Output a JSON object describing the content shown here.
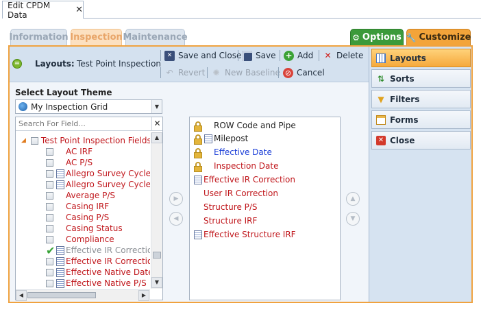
{
  "window": {
    "doc_tab_title": "Edit CPDM Data",
    "close_glyph": "✕"
  },
  "section_tabs": {
    "information": "Information",
    "inspection": "Inspection",
    "maintenance": "Maintenance",
    "options": "Options",
    "customize": "Customize"
  },
  "toolbar": {
    "layouts_label": "Layouts:",
    "layouts_value": "Test Point Inspection",
    "save_and_close": "Save and Close",
    "save": "Save",
    "add": "Add",
    "delete": "Delete",
    "revert": "Revert",
    "new_baseline": "New Baseline",
    "cancel": "Cancel"
  },
  "theme": {
    "label": "Select Layout Theme",
    "selected": "My Inspection Grid"
  },
  "search": {
    "placeholder": "Search For Field..."
  },
  "available_fields": {
    "group": "Test Point Inspection Fields",
    "items": [
      {
        "label": "AC IRF"
      },
      {
        "label": "AC P/S"
      },
      {
        "label": "Allegro Survey Cycle C"
      },
      {
        "label": "Allegro Survey Cycle C"
      },
      {
        "label": "Average P/S"
      },
      {
        "label": "Casing IRF"
      },
      {
        "label": "Casing P/S"
      },
      {
        "label": "Casing Status"
      },
      {
        "label": "Compliance"
      },
      {
        "label": "Effective IR Correction"
      },
      {
        "label": "Effective IR Correction"
      },
      {
        "label": "Effective Native Date"
      },
      {
        "label": "Effective Native P/S"
      }
    ]
  },
  "selected_fields": [
    {
      "label": "ROW Code and Pipe"
    },
    {
      "label": "Milepost"
    },
    {
      "label": "Effective Date"
    },
    {
      "label": "Inspection Date"
    },
    {
      "label": "Effective IR Correction"
    },
    {
      "label": "User IR Correction"
    },
    {
      "label": "Structure P/S"
    },
    {
      "label": "Structure IRF"
    },
    {
      "label": "Effective Structure IRF"
    }
  ],
  "side_nav": {
    "layouts": "Layouts",
    "sorts": "Sorts",
    "filters": "Filters",
    "forms": "Forms",
    "close": "Close"
  },
  "colors": {
    "accent_orange": "#f0a23f",
    "field_red": "#c0161b",
    "field_blue": "#1c3fd8",
    "options_green": "#3c9a3a"
  }
}
